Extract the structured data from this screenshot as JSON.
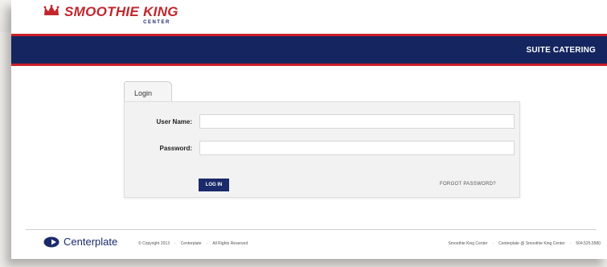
{
  "brand": {
    "name": "SMOOTHIE KING",
    "sub": "CENTER",
    "colors": {
      "red": "#cc1f2a",
      "navy": "#15255f"
    }
  },
  "nav": {
    "title": "SUITE CATERING"
  },
  "login": {
    "tab_label": "Login",
    "username_label": "User Name:",
    "username_value": "",
    "password_label": "Password:",
    "password_value": "",
    "submit_label": "LOG IN",
    "forgot_label": "FORGOT PASSWORD?"
  },
  "footer": {
    "logo_text": "Centerplate",
    "copyright": "© Copyright 2013",
    "company": "Centerplate",
    "rights": "All Rights Reserved",
    "venue": "Smoothie King Center",
    "venue_catering": "Centerplate @ Smoothie King Center",
    "phone": "504.525.5580"
  },
  "icons": [
    "crown-icon",
    "centerplate-logo-icon"
  ]
}
